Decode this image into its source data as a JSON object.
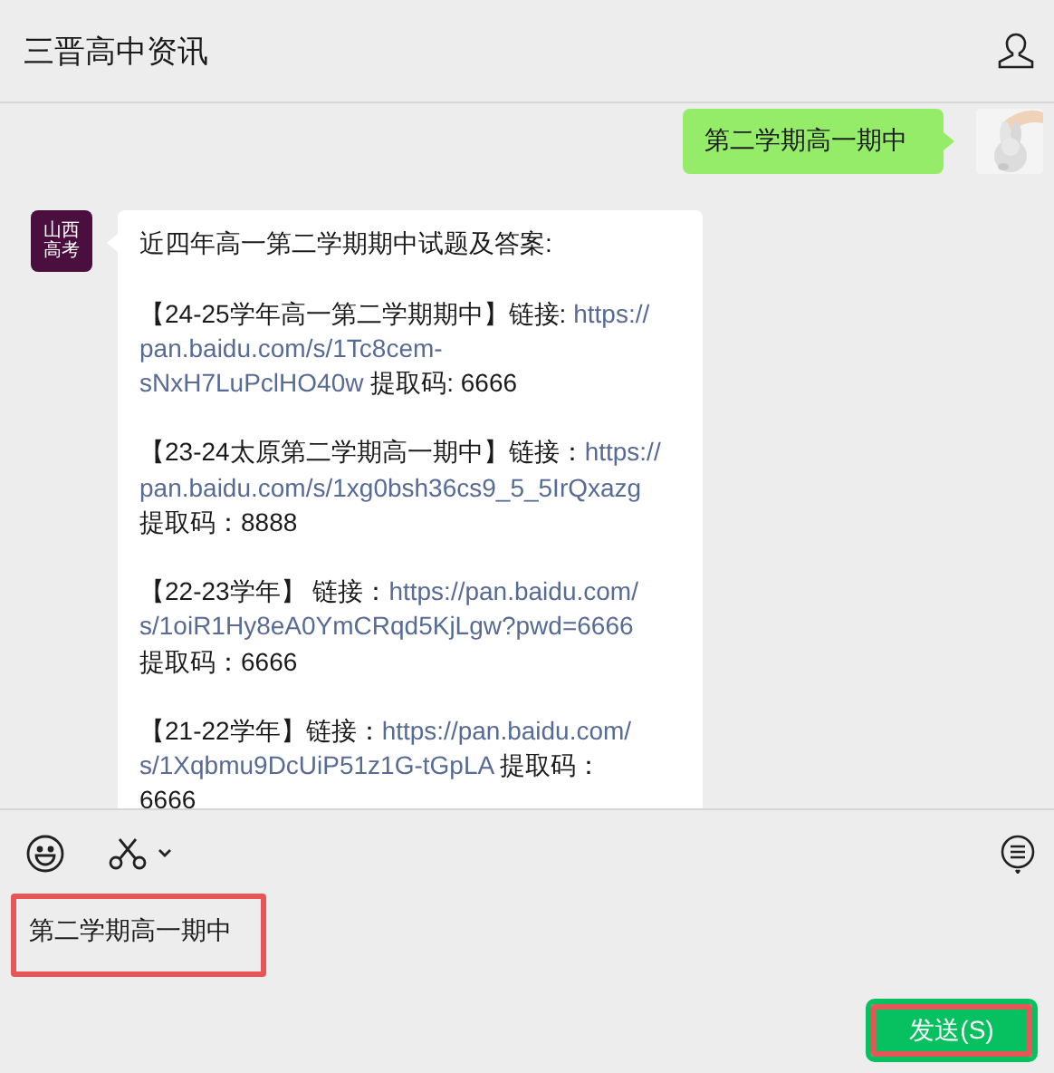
{
  "window": {
    "title": "三晋高中资讯"
  },
  "messages": [
    {
      "kind": "sent",
      "paragraphs": [
        [
          [
            {
              "kind": "plain",
              "text": "第二学期高一期中"
            }
          ]
        ]
      ]
    },
    {
      "kind": "received",
      "avatar": [
        "山西",
        "高考"
      ],
      "paragraphs": [
        [
          [
            {
              "kind": "plain",
              "text": "近四年高一第二学期期中试题及答案:"
            }
          ]
        ],
        [
          [
            {
              "kind": "plain",
              "text": "【24-25学年高一第二学期期中】链接: "
            },
            {
              "kind": "link",
              "text": "https://"
            }
          ],
          [
            {
              "kind": "link",
              "text": "pan.baidu.com/s/1Tc8cem-"
            }
          ],
          [
            {
              "kind": "link",
              "text": "sNxH7LuPclHO40w"
            },
            {
              "kind": "plain",
              "text": " 提取码: 6666"
            }
          ]
        ],
        [
          [
            {
              "kind": "plain",
              "text": "【23-24太原第二学期高一期中】链接："
            },
            {
              "kind": "link",
              "text": "https://"
            }
          ],
          [
            {
              "kind": "link",
              "text": "pan.baidu.com/s/1xg0bsh36cs9_5_5IrQxazg"
            }
          ],
          [
            {
              "kind": "plain",
              "text": "提取码：8888"
            }
          ]
        ],
        [
          [
            {
              "kind": "plain",
              "text": "【22-23学年】 链接："
            },
            {
              "kind": "link",
              "text": "https://pan.baidu.com/"
            }
          ],
          [
            {
              "kind": "link",
              "text": "s/1oiR1Hy8eA0YmCRqd5KjLgw?pwd=6666"
            }
          ],
          [
            {
              "kind": "plain",
              "text": "提取码：6666"
            }
          ]
        ],
        [
          [
            {
              "kind": "plain",
              "text": "【21-22学年】链接："
            },
            {
              "kind": "link",
              "text": "https://pan.baidu.com/"
            }
          ],
          [
            {
              "kind": "link",
              "text": "s/1Xqbmu9DcUiP51z1G-tGpLA"
            },
            {
              "kind": "plain",
              "text": " 提取码："
            }
          ],
          [
            {
              "kind": "plain",
              "text": "6666"
            }
          ]
        ]
      ]
    }
  ],
  "composer": {
    "value": "第二学期高一期中",
    "send_button": "发送(S)"
  }
}
